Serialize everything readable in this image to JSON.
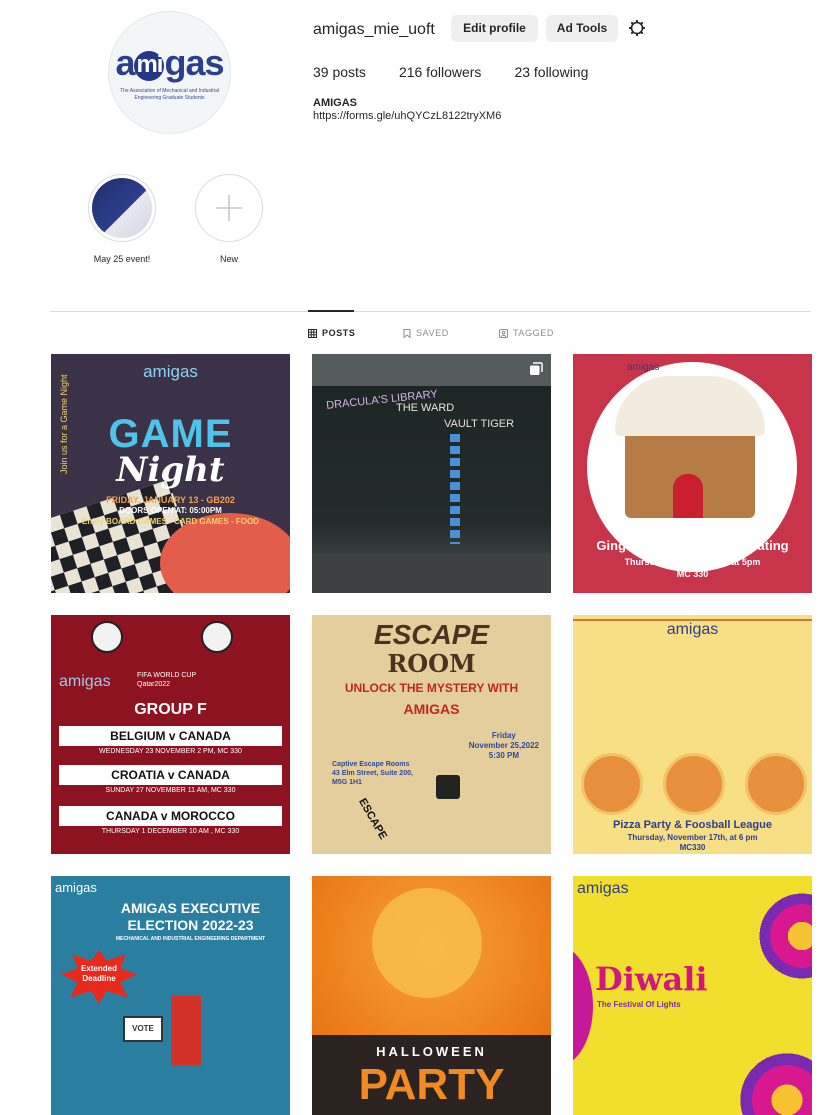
{
  "profile": {
    "username": "amigas_mie_uoft",
    "edit_profile": "Edit profile",
    "ad_tools": "Ad Tools",
    "settings_icon": "gear-icon",
    "posts": "39 posts",
    "followers": "216 followers",
    "following": "23 following",
    "bio_name": "AMIGAS",
    "bio_link": "https://forms.gle/uhQYCzL8122tryXM6",
    "logo_word_a": "a",
    "logo_word_mid": "mi",
    "logo_word_end": "gas",
    "logo_subtitle": "The Association of Mechanical and Industrial Engineering Graduate Students"
  },
  "highlights": [
    {
      "label": "May 25 event!"
    },
    {
      "label": "New",
      "icon": "plus-icon"
    }
  ],
  "tabs": [
    {
      "label": "POSTS",
      "icon": "grid-icon",
      "active": true
    },
    {
      "label": "SAVED",
      "icon": "bookmark-icon",
      "active": false
    },
    {
      "label": "TAGGED",
      "icon": "tag-icon",
      "active": false
    }
  ],
  "posts": [
    {
      "brand": "amigas",
      "title_a": "GAME",
      "title_b": "Night",
      "side": "Join us for a Game Night",
      "line1": "FRIDAY, JANUARY 13 - GB202",
      "line2": "DOORS OPEN AT: 05:00PM",
      "line3": "Enjoy BOARD GAMES - CARD GAMES - FOOD"
    },
    {
      "board_a": "DRACULA'S LIBRARY",
      "board_b": "THE WARD",
      "board_c": "VAULT TIGER",
      "multi_icon": "carousel-icon"
    },
    {
      "brand": "amigas",
      "caption": "Gingerbread House Decorating",
      "line1": "Thursday, December 8th at 5pm",
      "line2": "MC 330"
    },
    {
      "brand": "amigas",
      "event": "FIFA WORLD CUP Qatar2022",
      "group": "GROUP F",
      "matches": [
        {
          "title": "BELGIUM v CANADA",
          "when": "WEDNESDAY 23 NOVEMBER  2 PM, MC 330"
        },
        {
          "title": "CROATIA v CANADA",
          "when": "SUNDAY 27 NOVEMBER  11 AM, MC 330"
        },
        {
          "title": "CANADA v MOROCCO",
          "when": "THURSDAY 1 DECEMBER  10 AM , MC 330"
        }
      ]
    },
    {
      "title_a": "ESCAPE",
      "title_b": "ROOM",
      "tagline_a": "UNLOCK THE MYSTERY WITH",
      "tagline_b": "AMIGAS",
      "date_a": "Friday",
      "date_b": "November 25,2022",
      "date_c": "5:30 PM",
      "place_a": "Captive Escape Rooms",
      "place_b": "43 Elm Street, Suite 200,",
      "place_c": "M5G 1H1",
      "arrow": "ESCAPE"
    },
    {
      "brand": "amigas",
      "caption": "Pizza Party & Foosball League",
      "line1": "Thursday, November 17th, at 6 pm",
      "line2": "MC330"
    },
    {
      "brand": "amigas",
      "title_a": "AMIGAS EXECUTIVE",
      "title_b": "ELECTION 2022-23",
      "dept": "MECHANICAL AND INDUSTRIAL ENGINEERING DEPARTMENT",
      "burst": "Extended Deadline",
      "vote": "VOTE"
    },
    {
      "title_a": "HALLOWEEN",
      "title_b": "PARTY"
    },
    {
      "brand": "amigas",
      "title": "Diwali",
      "sub": "The Festival Of Lights"
    }
  ],
  "colors": {
    "accent": "#262626",
    "muted": "#8e8e8e",
    "button_bg": "#efefef",
    "divider": "#dbdbdb",
    "brand_blue": "#2b3f8e"
  }
}
